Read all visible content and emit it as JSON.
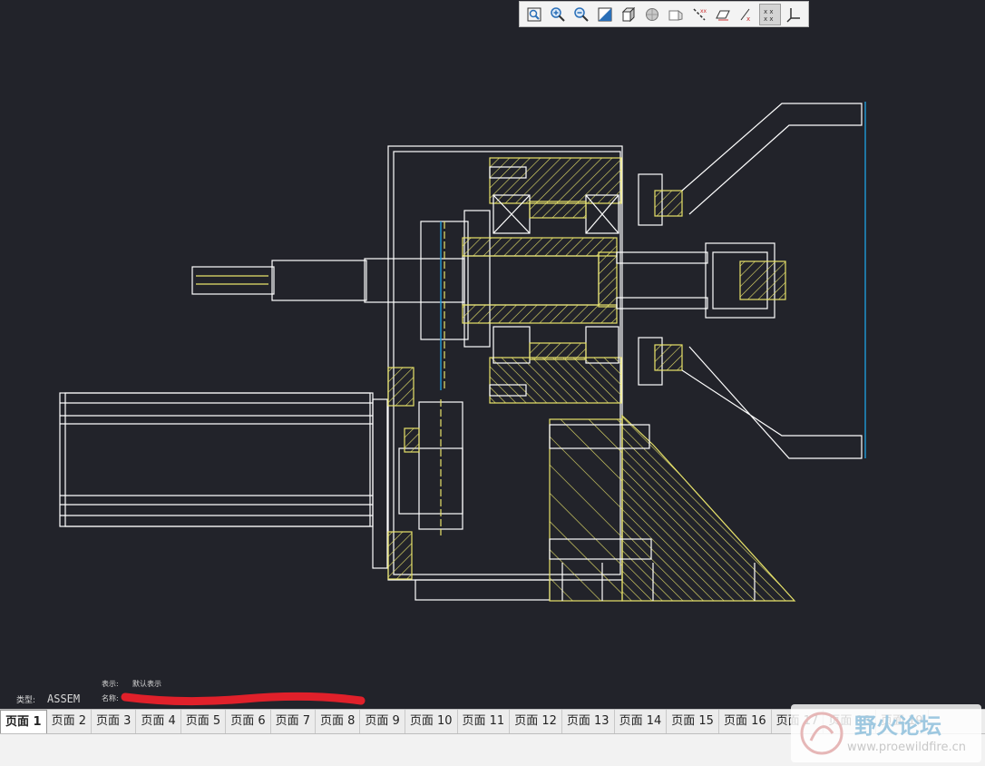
{
  "toolbar": {
    "buttons": [
      {
        "name": "zoom-fit-icon"
      },
      {
        "name": "zoom-in-icon"
      },
      {
        "name": "zoom-out-icon"
      },
      {
        "name": "repaint-icon"
      },
      {
        "name": "shaded-display-icon"
      },
      {
        "name": "hidden-line-icon"
      },
      {
        "name": "no-hidden-icon"
      },
      {
        "name": "datum-axis-icon"
      },
      {
        "name": "datum-plane-icon"
      },
      {
        "name": "datum-point-icon"
      },
      {
        "name": "csys-toggle-icon",
        "active": true
      },
      {
        "name": "coordinate-system-icon"
      }
    ]
  },
  "drawing_info": {
    "display_label": "表示:",
    "display_value": "默认表示",
    "type_label": "类型:",
    "type_value": "ASSEM",
    "name_label": "名称:"
  },
  "tabs": [
    "页面 1",
    "页面 2",
    "页面 3",
    "页面 4",
    "页面 5",
    "页面 6",
    "页面 7",
    "页面 8",
    "页面 9",
    "页面 10",
    "页面 11",
    "页面 12",
    "页面 13",
    "页面 14",
    "页面 15",
    "页面 16",
    "页面 17",
    "页面 18",
    "页面 19"
  ],
  "watermark": {
    "title": "野火论坛",
    "url": "www.proewildfire.cn"
  },
  "colors": {
    "background": "#22232a",
    "line": "#ffffff",
    "hatch": "#e8e36a",
    "axis": "#1e9bd7",
    "redact": "#e0202a"
  }
}
